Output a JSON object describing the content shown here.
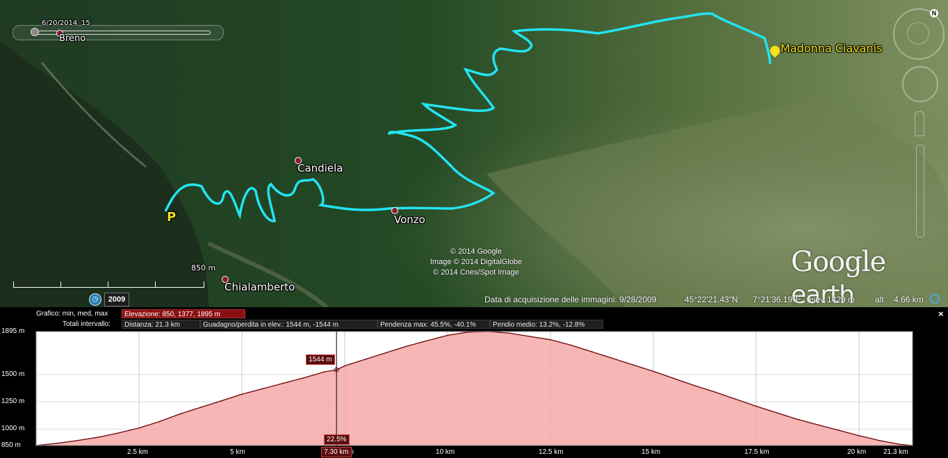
{
  "map": {
    "time_slider_date": "6/20/2014",
    "time_slider_end": "15",
    "places": [
      {
        "name": "Breno",
        "id": "breno"
      },
      {
        "name": "Candiela",
        "id": "candiela"
      },
      {
        "name": "Vonzo",
        "id": "vonzo"
      },
      {
        "name": "Chialamberto",
        "id": "chialamberto"
      }
    ],
    "destination": "Madonna Ciavanis",
    "start_marker": "P",
    "credits": [
      "© 2014 Google",
      "Image © 2014 DigitalGlobe",
      "© 2014 Cnes/Spot Image"
    ],
    "scale_label": "850 m",
    "year_button": "2009",
    "logo_google": "Google",
    "logo_earth": "earth",
    "track_color": "#22e4f2",
    "status": {
      "acquisition": "Data di acquisizione delle immagini: 9/28/2009",
      "lat": "45°22'21.43\"N",
      "lon": "7°21'36.19\"E",
      "elev_label": "elev",
      "elev": "1429 m",
      "alt_label": "alt",
      "alt": "4.66 km"
    }
  },
  "profile": {
    "close": "×",
    "row1_label": "Grafico: min, med, max",
    "row1_elev": "Elevazione: 850, 1377, 1895 m",
    "row2_label": "Totali intervallo:",
    "row2_items": [
      "Distanza: 21.3 km",
      "Guadagno/perdita in elev.: 1544 m, -1544 m",
      "Pendenza max: 45.5%, -40.1%",
      "Pendio medio: 13.2%, -12.8%"
    ],
    "cursor": {
      "elevation": "1544 m",
      "slope": "22.5%",
      "distance": "7.30 km",
      "distance_km": 7.3,
      "elev_m": 1544
    }
  },
  "chart_data": {
    "type": "area",
    "title": "",
    "xlabel": "",
    "ylabel": "",
    "xlim": [
      0,
      21.3
    ],
    "ylim": [
      850,
      1895
    ],
    "y_ticks": [
      "1895 m",
      "1500 m",
      "1250 m",
      "1000 m",
      "850 m"
    ],
    "y_tick_values": [
      1895,
      1500,
      1250,
      1000,
      850
    ],
    "x_ticks": [
      "2.5 km",
      "5 km",
      "7.5 km",
      "10 km",
      "12.5 km",
      "15 km",
      "17.5 km",
      "20 km",
      "21.3 km"
    ],
    "x_tick_values": [
      2.5,
      5,
      7.5,
      10,
      12.5,
      15,
      17.5,
      20,
      21.3
    ],
    "grid": true,
    "series": [
      {
        "x": [
          0,
          0.5,
          1,
          1.5,
          2,
          2.5,
          3,
          3.5,
          4,
          4.5,
          5,
          5.5,
          6,
          6.5,
          7,
          7.3,
          7.5,
          8,
          8.5,
          9,
          9.5,
          10,
          10.5,
          11,
          11.5,
          12,
          12.5,
          13,
          13.5,
          14,
          14.5,
          15,
          15.5,
          16,
          16.5,
          17,
          17.5,
          18,
          18.5,
          19,
          19.5,
          20,
          20.5,
          21,
          21.3
        ],
        "y": [
          850,
          870,
          895,
          925,
          965,
          1010,
          1070,
          1140,
          1200,
          1260,
          1320,
          1370,
          1420,
          1470,
          1525,
          1544,
          1580,
          1640,
          1700,
          1760,
          1810,
          1860,
          1890,
          1895,
          1880,
          1850,
          1820,
          1770,
          1710,
          1650,
          1590,
          1530,
          1465,
          1400,
          1340,
          1275,
          1210,
          1150,
          1090,
          1040,
          990,
          940,
          895,
          860,
          850
        ]
      }
    ],
    "fill_color": "#f4a9a9",
    "line_color": "#6b0000"
  }
}
